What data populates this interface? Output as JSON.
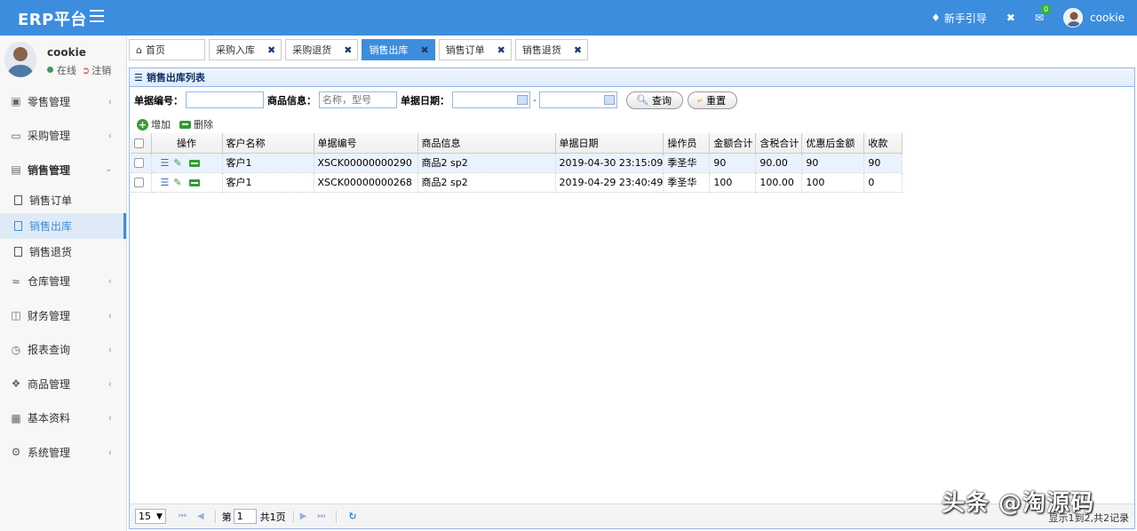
{
  "app": {
    "brand": "ERP平台",
    "header": {
      "guide": "新手引导",
      "mail_count": "0",
      "username": "cookie"
    }
  },
  "sidebar": {
    "user": {
      "name": "cookie",
      "status": "在线",
      "logout": "注销"
    },
    "items": [
      {
        "label": "零售管理",
        "icon": "gift-icon"
      },
      {
        "label": "采购管理",
        "icon": "monitor-icon"
      },
      {
        "label": "销售管理",
        "icon": "briefcase-icon"
      },
      {
        "label": "仓库管理",
        "icon": "layers-icon"
      },
      {
        "label": "财务管理",
        "icon": "columns-icon"
      },
      {
        "label": "报表查询",
        "icon": "clock-icon"
      },
      {
        "label": "商品管理",
        "icon": "dropbox-icon"
      },
      {
        "label": "基本资料",
        "icon": "grid-icon"
      },
      {
        "label": "系统管理",
        "icon": "gear-icon"
      }
    ],
    "sales_sub": [
      {
        "label": "销售订单",
        "active": false
      },
      {
        "label": "销售出库",
        "active": true
      },
      {
        "label": "销售退货",
        "active": false
      }
    ]
  },
  "tabs": [
    {
      "label": "首页",
      "closable": false,
      "active": false
    },
    {
      "label": "采购入库",
      "closable": true,
      "active": false
    },
    {
      "label": "采购退货",
      "closable": true,
      "active": false
    },
    {
      "label": "销售出库",
      "closable": true,
      "active": true
    },
    {
      "label": "销售订单",
      "closable": true,
      "active": false
    },
    {
      "label": "销售退货",
      "closable": true,
      "active": false
    }
  ],
  "panel": {
    "title": "销售出库列表",
    "search": {
      "number_label": "单据编号：",
      "number_value": "",
      "goods_label": "商品信息：",
      "goods_placeholder": "名称，型号",
      "date_label": "单据日期：",
      "date_sep": "-",
      "query_button": "查询",
      "reset_button": "重置"
    },
    "toolbar": {
      "add": "增加",
      "delete": "删除"
    },
    "columns": [
      "操作",
      "客户名称",
      "单据编号",
      "商品信息",
      "单据日期",
      "操作员",
      "金额合计",
      "含税合计",
      "优惠后金额",
      "收款"
    ],
    "rows": [
      {
        "customer": "客户1",
        "number": "XSCK00000000290",
        "goods": "商品2 sp2",
        "date": "2019-04-30 23:15:09",
        "operator": "季圣华",
        "amount": "90",
        "tax_amount": "90.00",
        "discounted": "90",
        "received": "90"
      },
      {
        "customer": "客户1",
        "number": "XSCK00000000268",
        "goods": "商品2 sp2",
        "date": "2019-04-29 23:40:49",
        "operator": "季圣华",
        "amount": "100",
        "tax_amount": "100.00",
        "discounted": "100",
        "received": "0"
      }
    ],
    "pager": {
      "page_size": "15",
      "page_prefix": "第",
      "page_value": "1",
      "page_total": "共1页",
      "info": "显示1到2,共2记录"
    }
  },
  "watermark": "头条 @淘源码"
}
